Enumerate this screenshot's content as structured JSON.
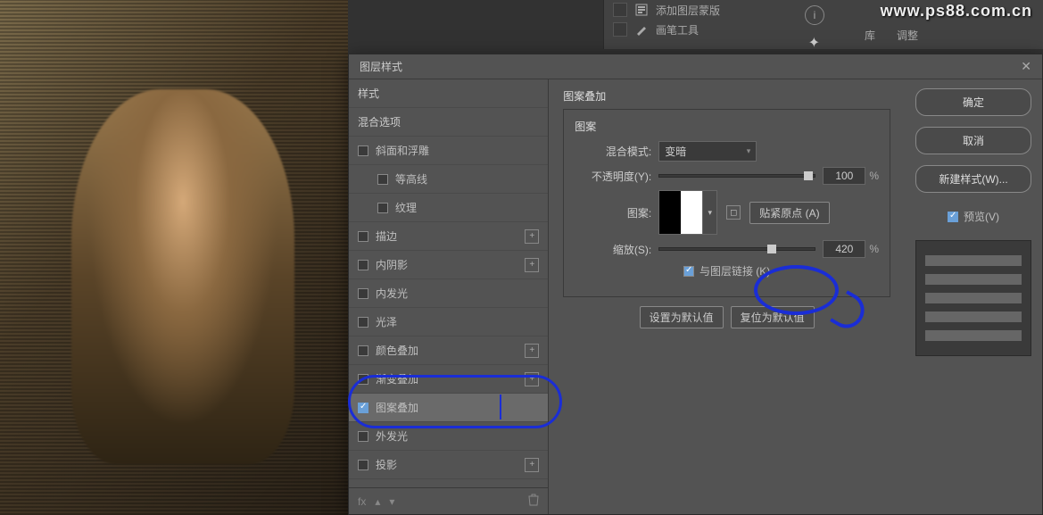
{
  "watermark": "www.ps88.com.cn",
  "top_tools": {
    "item1": "添加图层蒙版",
    "item2": "画笔工具",
    "tab1": "库",
    "tab2": "调整"
  },
  "dialog": {
    "title": "图层样式",
    "close": "✕",
    "styles_header": "样式",
    "blend_options": "混合选项",
    "items": {
      "bevel": "斜面和浮雕",
      "contour": "等高线",
      "texture": "纹理",
      "stroke": "描边",
      "inner_shadow": "内阴影",
      "inner_glow": "内发光",
      "satin": "光泽",
      "color_overlay": "颜色叠加",
      "gradient_overlay": "渐变叠加",
      "pattern_overlay": "图案叠加",
      "outer_glow": "外发光",
      "drop_shadow": "投影"
    },
    "fx_label": "fx"
  },
  "center": {
    "title": "图案叠加",
    "group": "图案",
    "blend_mode_label": "混合模式:",
    "blend_mode_value": "变暗",
    "opacity_label": "不透明度(Y):",
    "opacity_value": "100",
    "opacity_unit": "%",
    "pattern_label": "图案:",
    "snap_origin": "贴紧原点 (A)",
    "scale_label": "缩放(S):",
    "scale_value": "420",
    "scale_unit": "%",
    "link_layer": "与图层链接 (K)",
    "set_default": "设置为默认值",
    "reset_default": "复位为默认值"
  },
  "right": {
    "ok": "确定",
    "cancel": "取消",
    "new_style": "新建样式(W)...",
    "preview": "预览(V)"
  }
}
